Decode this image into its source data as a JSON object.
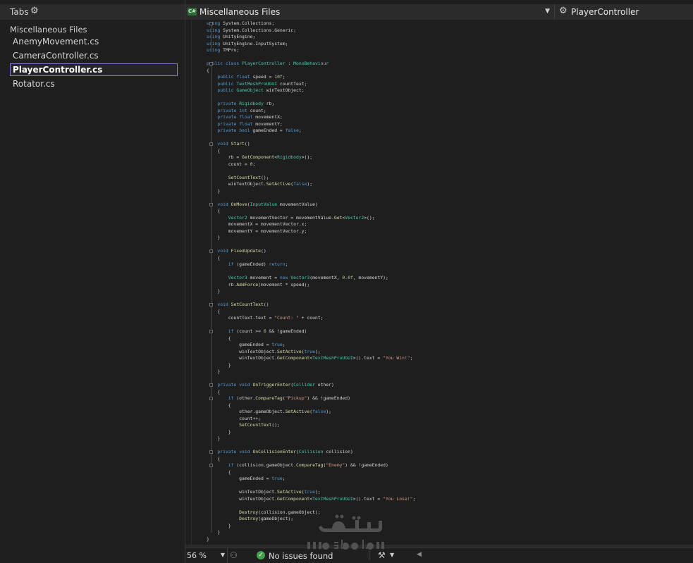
{
  "tabs_panel": {
    "title": "Tabs",
    "group": "Miscellaneous Files",
    "items": [
      {
        "label": "AnemyMovement.cs",
        "selected": false
      },
      {
        "label": "CameraController.cs",
        "selected": false
      },
      {
        "label": "PlayerController.cs",
        "selected": true
      },
      {
        "label": "Rotator.cs",
        "selected": false
      }
    ]
  },
  "navbar": {
    "project_icon": "C#",
    "project": "Miscellaneous Files",
    "member": "PlayerController"
  },
  "editor": {
    "lines": [
      "using System.Collections;",
      "using System.Collections.Generic;",
      "using UnityEngine;",
      "using UnityEngine.InputSystem;",
      "using TMPro;",
      "",
      "public class PlayerController : MonoBehaviour",
      "{",
      "    public float speed = 10f;",
      "    public TextMeshProUGUI countText;",
      "    public GameObject winTextObject;",
      "",
      "    private Rigidbody rb;",
      "    private int count;",
      "    private float movementX;",
      "    private float movementY;",
      "    private bool gameEnded = false;",
      "",
      "    void Start()",
      "    {",
      "        rb = GetComponent<Rigidbody>();",
      "        count = 0;",
      "",
      "        SetCountText();",
      "        winTextObject.SetActive(false);",
      "    }",
      "",
      "    void OnMove(InputValue movementValue)",
      "    {",
      "        Vector2 movementVector = movementValue.Get<Vector2>();",
      "        movementX = movementVector.x;",
      "        movementY = movementVector.y;",
      "    }",
      "",
      "    void FixedUpdate()",
      "    {",
      "        if (gameEnded) return;",
      "",
      "        Vector3 movement = new Vector3(movementX, 0.0f, movementY);",
      "        rb.AddForce(movement * speed);",
      "    }",
      "",
      "    void SetCountText()",
      "    {",
      "        countText.text = \"Count: \" + count;",
      "",
      "        if (count >= 6 && !gameEnded)",
      "        {",
      "            gameEnded = true;",
      "            winTextObject.SetActive(true);",
      "            winTextObject.GetComponent<TextMeshProUGUI>().text = \"You Win!\";",
      "        }",
      "    }",
      "",
      "    private void OnTriggerEnter(Collider other)",
      "    {",
      "        if (other.CompareTag(\"Pickup\") && !gameEnded)",
      "        {",
      "            other.gameObject.SetActive(false);",
      "            count++;",
      "            SetCountText();",
      "        }",
      "    }",
      "",
      "    private void OnCollisionEnter(Collision collision)",
      "    {",
      "        if (collision.gameObject.CompareTag(\"Enemy\") && !gameEnded)",
      "        {",
      "            gameEnded = true;",
      "",
      "            winTextObject.SetActive(true);",
      "            winTextObject.GetComponent<TextMeshProUGUI>().text = \"You Lose!\";",
      "",
      "            Destroy(collision.gameObject);",
      "            Destroy(gameObject);",
      "        }",
      "    }",
      "}"
    ]
  },
  "status": {
    "zoom": "56 %",
    "issues": "No issues found"
  },
  "watermark": {
    "arabic": "مستقل",
    "latin": "mostaql.com"
  },
  "colors": {
    "selection_border": "#8a7bd1",
    "ok_green": "#3fa24a",
    "keyword": "#569cd6",
    "type": "#4ec9b0"
  }
}
